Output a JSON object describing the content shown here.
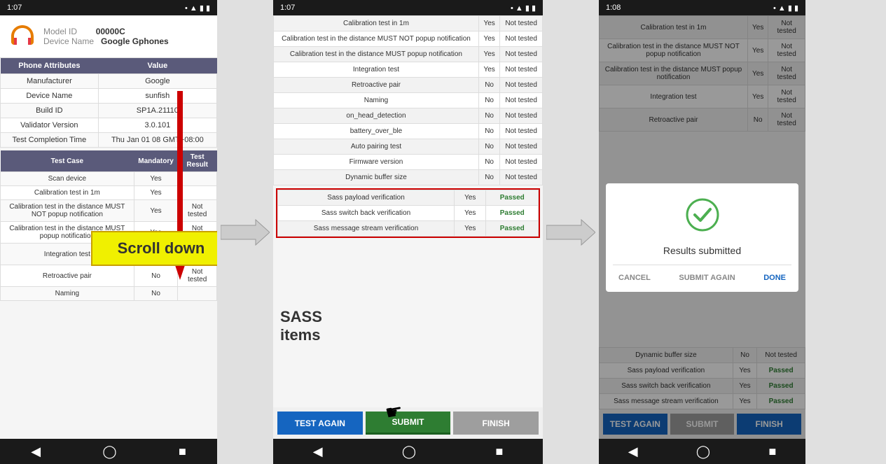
{
  "phone1": {
    "status_time": "1:07",
    "model_id_label": "Model ID",
    "model_id_value": "00000C",
    "device_name_label": "Device Name",
    "device_name_value": "Google Gphones",
    "attributes_headers": [
      "Phone Attributes",
      "Value"
    ],
    "attributes_rows": [
      [
        "Manufacturer",
        "Google"
      ],
      [
        "Device Name",
        "sunfish"
      ],
      [
        "Build ID",
        "SP1A.21110"
      ],
      [
        "Validator Version",
        "3.0.101"
      ],
      [
        "Test Completion Time",
        "Thu Jan 01 08 GMT+08:00"
      ]
    ],
    "test_headers": [
      "Test Case",
      "Mandatory",
      "Test Result"
    ],
    "test_rows": [
      [
        "Scan device",
        "Yes",
        ""
      ],
      [
        "Calibration test in 1m",
        "Yes",
        ""
      ],
      [
        "Calibration test in the distance MUST NOT popup notification",
        "Yes",
        "Not tested"
      ],
      [
        "Calibration test in the distance MUST popup notification",
        "Yes",
        "Not tested"
      ],
      [
        "Integration test",
        "Yes",
        "Not tested"
      ],
      [
        "Retroactive pair",
        "No",
        "Not tested"
      ],
      [
        "Naming",
        "No",
        ""
      ]
    ],
    "scroll_down_label": "Scroll down"
  },
  "phone2": {
    "status_time": "1:07",
    "test_rows": [
      [
        "Calibration test in 1m",
        "Yes",
        "Not tested"
      ],
      [
        "Calibration test in the distance MUST NOT popup notification",
        "Yes",
        "Not tested"
      ],
      [
        "Calibration test in the distance MUST popup notification",
        "Yes",
        "Not tested"
      ],
      [
        "Integration test",
        "Yes",
        "Not tested"
      ],
      [
        "Retroactive pair",
        "No",
        "Not tested"
      ],
      [
        "Naming",
        "No",
        "Not tested"
      ],
      [
        "on_head_detection",
        "No",
        "Not tested"
      ],
      [
        "battery_over_ble",
        "No",
        "Not tested"
      ],
      [
        "Auto pairing test",
        "No",
        "Not tested"
      ],
      [
        "Firmware version",
        "No",
        "Not tested"
      ],
      [
        "Dynamic buffer size",
        "No",
        "Not tested"
      ]
    ],
    "sass_rows": [
      [
        "Sass payload verification",
        "Yes",
        "Passed"
      ],
      [
        "Sass switch back verification",
        "Yes",
        "Passed"
      ],
      [
        "Sass message stream verification",
        "Yes",
        "Passed"
      ]
    ],
    "sass_label": "SASS\nitems",
    "buttons": {
      "test_again": "TEST AGAIN",
      "submit": "SUBMIT",
      "finish": "FINISH"
    },
    "submit_annotation": "submit"
  },
  "phone3": {
    "status_time": "1:08",
    "test_rows": [
      [
        "Calibration test in 1m",
        "Yes",
        "Not tested"
      ],
      [
        "Calibration test in the distance MUST NOT popup notification",
        "Yes",
        "Not tested"
      ],
      [
        "Calibration test in the distance MUST popup notification",
        "Yes",
        "Not tested"
      ],
      [
        "Integration test",
        "Yes",
        "Not tested"
      ],
      [
        "Retroactive pair",
        "No",
        "Not tested"
      ]
    ],
    "below_dialog_rows": [
      [
        "Dynamic buffer size",
        "No",
        "Not tested"
      ],
      [
        "Sass payload verification",
        "Yes",
        "Passed"
      ],
      [
        "Sass switch back verification",
        "Yes",
        "Passed"
      ],
      [
        "Sass message stream verification",
        "Yes",
        "Passed"
      ]
    ],
    "dialog": {
      "check": "✓",
      "message": "Results submitted",
      "cancel": "CANCEL",
      "submit_again": "SUBMIT AGAIN",
      "done": "DONE"
    },
    "buttons": {
      "test_again": "TEST AGAIN",
      "submit": "SUBMIT",
      "finish": "FINISH"
    }
  },
  "arrows": {
    "right": "→"
  }
}
